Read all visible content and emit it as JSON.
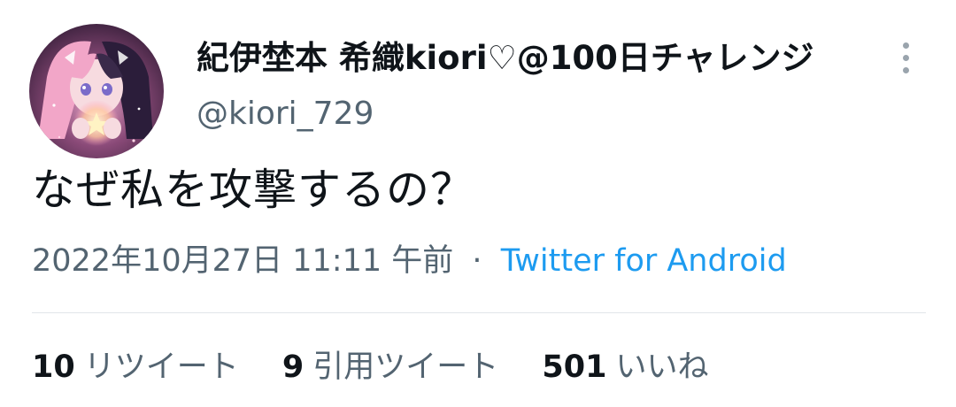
{
  "user": {
    "display_name": "紀伊埜本 希織kiori♡@100日チャレンジ",
    "handle": "@kiori_729",
    "avatar_icon": "profile-avatar-anime-girl"
  },
  "tweet": {
    "text": "なぜ私を攻撃するの？",
    "timestamp": "2022年10月27日 11:11 午前",
    "separator": "·",
    "source": "Twitter for Android"
  },
  "stats": {
    "retweets": {
      "count": "10",
      "label": "リツイート"
    },
    "quotes": {
      "count": "9",
      "label": "引用ツイート"
    },
    "likes": {
      "count": "501",
      "label": "いいね"
    }
  },
  "icons": {
    "more": "more-vertical-icon"
  },
  "colors": {
    "text_primary": "#0f1419",
    "text_secondary": "#536471",
    "link": "#1d9bf0",
    "divider": "#e1e6ea"
  }
}
